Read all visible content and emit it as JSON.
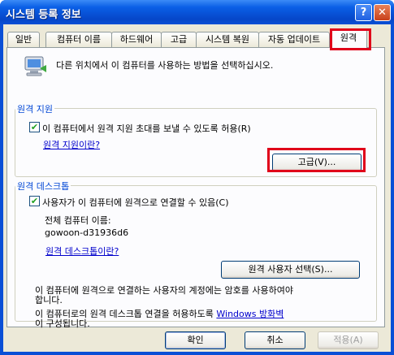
{
  "window": {
    "title": "시스템 등록 정보",
    "help_glyph": "?",
    "close_glyph": "✕"
  },
  "tabs": [
    {
      "label": "일반"
    },
    {
      "label": "컴퓨터 이름"
    },
    {
      "label": "하드웨어"
    },
    {
      "label": "고급"
    },
    {
      "label": "시스템 복원"
    },
    {
      "label": "자동 업데이트"
    },
    {
      "label": "원격"
    }
  ],
  "intro": {
    "text": "다른 위치에서 이 컴퓨터를 사용하는 방법을 선택하십시오.",
    "icon": "remote-computer-icon"
  },
  "remote_assistance": {
    "group_label": "원격 지원",
    "checkbox_label": "이 컴퓨터에서 원격 지원 초대를 보낼 수 있도록 허용(R)",
    "checked": true,
    "link": "원격 지원이란?",
    "advanced_button": "고급(V)..."
  },
  "remote_desktop": {
    "group_label": "원격 데스크톱",
    "checkbox_label": "사용자가 이 컴퓨터에 원격으로 연결할 수 있음(C)",
    "checked": true,
    "full_name_label": "전체 컴퓨터 이름:",
    "full_name_value": "gowoon-d31936d6",
    "link": "원격 데스크톱이란?",
    "select_users_button": "원격 사용자 선택(S)...",
    "note_line1": "이 컴퓨터에 원격으로 연결하는 사용자의 계정에는 암호를 사용하여야",
    "note_line2": "합니다.",
    "firewall_line1_text": "이 컴퓨터로의 원격 데스크톱 연결을 허용하도록",
    "firewall_link": "Windows 방화벽",
    "firewall_line2": "이 구성됩니다."
  },
  "footer": {
    "ok": "확인",
    "cancel": "취소",
    "apply": "적용(A)"
  },
  "colors": {
    "title_bar": "#0a4fd6",
    "highlight": "#e0001a",
    "link": "#0000cc",
    "group_label": "#0046d5"
  }
}
